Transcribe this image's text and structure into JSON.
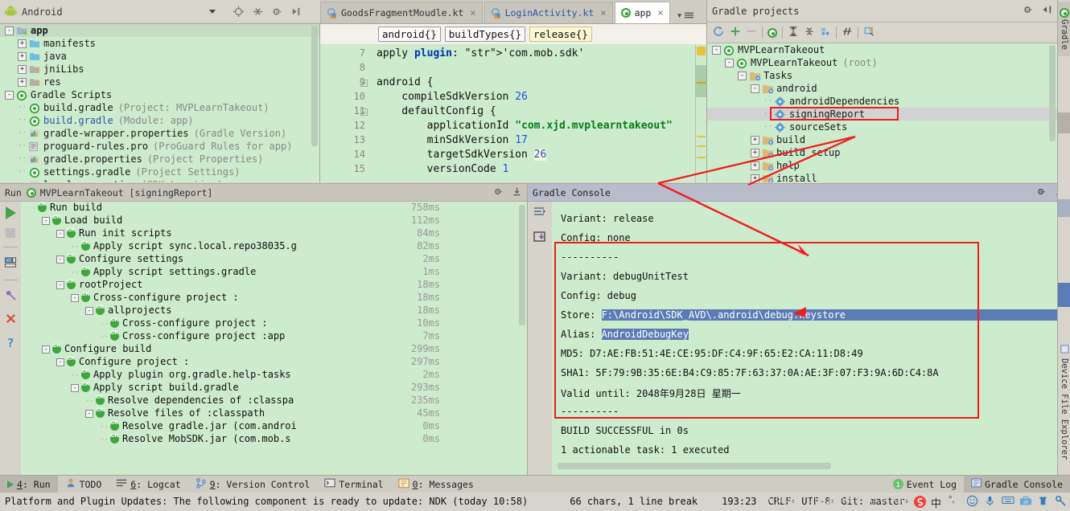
{
  "window": {
    "project_panel_title": "Android",
    "gradle_panel_title": "Gradle projects",
    "run_panel_title": "Run",
    "run_config": "MVPLearnTakeout [signingReport]",
    "console_title": "Gradle Console"
  },
  "editor_tabs": [
    {
      "label": "GoodsFragmentMoudle.kt",
      "icon": "kotlin-file-icon",
      "active": false,
      "close": "×"
    },
    {
      "label": "LoginActivity.kt",
      "icon": "kotlin-file-icon",
      "active": false,
      "close": "×"
    },
    {
      "label": "app",
      "icon": "gradle-file-icon",
      "active": true,
      "close": "×"
    }
  ],
  "breadcrumbs": [
    {
      "label": "android{}",
      "highlight": false
    },
    {
      "label": "buildTypes{}",
      "highlight": false
    },
    {
      "label": "release{}",
      "highlight": true
    }
  ],
  "project_tree": [
    {
      "indent": 0,
      "expander": "-",
      "icon": "folder-module-icon",
      "label": "app",
      "sub": "",
      "bold": true
    },
    {
      "indent": 1,
      "expander": "+",
      "icon": "folder-blue-icon",
      "label": "manifests",
      "sub": ""
    },
    {
      "indent": 1,
      "expander": "+",
      "icon": "folder-blue-icon",
      "label": "java",
      "sub": ""
    },
    {
      "indent": 1,
      "expander": "+",
      "icon": "folder-grey-icon",
      "label": "jniLibs",
      "sub": ""
    },
    {
      "indent": 1,
      "expander": "+",
      "icon": "folder-grey-icon",
      "label": "res",
      "sub": ""
    },
    {
      "indent": 0,
      "expander": "-",
      "icon": "gradle-icon",
      "label": "Gradle Scripts",
      "sub": ""
    },
    {
      "indent": 1,
      "expander": "",
      "icon": "gradle-icon",
      "label": "build.gradle",
      "sub": "(Project: MVPLearnTakeout)"
    },
    {
      "indent": 1,
      "expander": "",
      "icon": "gradle-icon",
      "label": "build.gradle",
      "sub": "(Module: app)",
      "link": true
    },
    {
      "indent": 1,
      "expander": "",
      "icon": "properties-icon",
      "label": "gradle-wrapper.properties",
      "sub": "(Gradle Version)"
    },
    {
      "indent": 1,
      "expander": "",
      "icon": "text-file-icon",
      "label": "proguard-rules.pro",
      "sub": "(ProGuard Rules for app)"
    },
    {
      "indent": 1,
      "expander": "",
      "icon": "properties-icon",
      "label": "gradle.properties",
      "sub": "(Project Properties)"
    },
    {
      "indent": 1,
      "expander": "",
      "icon": "gradle-icon",
      "label": "settings.gradle",
      "sub": "(Project Settings)"
    },
    {
      "indent": 1,
      "expander": "",
      "icon": "properties-icon",
      "label": "local.properties",
      "sub": "(SDK Location)"
    }
  ],
  "code": {
    "lines": [
      {
        "no": "7",
        "fold": "",
        "text": "apply plugin: 'com.mob.sdk'"
      },
      {
        "no": "8",
        "fold": "",
        "text": ""
      },
      {
        "no": "9",
        "fold": "-",
        "text": "android {"
      },
      {
        "no": "10",
        "fold": "",
        "text": "    compileSdkVersion 26"
      },
      {
        "no": "11",
        "fold": "-",
        "text": "    defaultConfig {"
      },
      {
        "no": "12",
        "fold": "",
        "text": "        applicationId \"com.xjd.mvplearntakeout\""
      },
      {
        "no": "13",
        "fold": "",
        "text": "        minSdkVersion 17"
      },
      {
        "no": "14",
        "fold": "",
        "text": "        targetSdkVersion 26"
      },
      {
        "no": "15",
        "fold": "",
        "text": "        versionCode 1"
      }
    ]
  },
  "gradle_tree": [
    {
      "indent": 0,
      "expander": "-",
      "icon": "gradle-icon",
      "label": "MVPLearnTakeout",
      "sub": ""
    },
    {
      "indent": 1,
      "expander": "-",
      "icon": "gradle-icon",
      "label": "MVPLearnTakeout",
      "sub": "(root)"
    },
    {
      "indent": 2,
      "expander": "-",
      "icon": "tasks-folder-icon",
      "label": "Tasks",
      "sub": ""
    },
    {
      "indent": 3,
      "expander": "-",
      "icon": "tasks-folder-icon",
      "label": "android",
      "sub": ""
    },
    {
      "indent": 4,
      "expander": "",
      "icon": "task-gear-icon",
      "label": "androidDependencies",
      "sub": ""
    },
    {
      "indent": 4,
      "expander": "",
      "icon": "task-gear-icon",
      "label": "signingReport",
      "sub": "",
      "selected": true,
      "boxed": true
    },
    {
      "indent": 4,
      "expander": "",
      "icon": "task-gear-icon",
      "label": "sourceSets",
      "sub": ""
    },
    {
      "indent": 3,
      "expander": "+",
      "icon": "tasks-folder-icon",
      "label": "build",
      "sub": ""
    },
    {
      "indent": 3,
      "expander": "+",
      "icon": "tasks-folder-icon",
      "label": "build setup",
      "sub": ""
    },
    {
      "indent": 3,
      "expander": "+",
      "icon": "tasks-folder-icon",
      "label": "help",
      "sub": ""
    },
    {
      "indent": 3,
      "expander": "+",
      "icon": "tasks-folder-icon",
      "label": "install",
      "sub": ""
    }
  ],
  "gradle_toolbar_icons": [
    "refresh-icon",
    "add-icon",
    "remove-icon",
    "run-task-icon",
    "expand-all-icon",
    "collapse-all-icon",
    "toggle-offline-icon",
    "execute-task-icon",
    "task-settings-icon"
  ],
  "run_toolbar_icons": [
    "rerun-icon",
    "stop-icon",
    "toggle-tasks-icon",
    "pin-icon",
    "close-icon",
    "help-icon"
  ],
  "run_tree": [
    {
      "indent": 0,
      "expander": "",
      "label": "Run build",
      "ms": "758ms"
    },
    {
      "indent": 1,
      "expander": "-",
      "label": "Load build",
      "ms": "112ms"
    },
    {
      "indent": 2,
      "expander": "-",
      "label": "Run init scripts",
      "ms": "84ms"
    },
    {
      "indent": 3,
      "expander": "",
      "label": "Apply script sync.local.repo38035.g",
      "ms": "82ms"
    },
    {
      "indent": 2,
      "expander": "-",
      "label": "Configure settings",
      "ms": "2ms"
    },
    {
      "indent": 3,
      "expander": "",
      "label": "Apply script settings.gradle",
      "ms": "1ms"
    },
    {
      "indent": 2,
      "expander": "-",
      "label": "rootProject",
      "ms": "18ms"
    },
    {
      "indent": 3,
      "expander": "-",
      "label": "Cross-configure project :",
      "ms": "18ms"
    },
    {
      "indent": 4,
      "expander": "-",
      "label": "allprojects",
      "ms": "18ms"
    },
    {
      "indent": 5,
      "expander": "",
      "label": "Cross-configure project :",
      "ms": "10ms"
    },
    {
      "indent": 5,
      "expander": "",
      "label": "Cross-configure project :app",
      "ms": "7ms"
    },
    {
      "indent": 1,
      "expander": "-",
      "label": "Configure build",
      "ms": "299ms"
    },
    {
      "indent": 2,
      "expander": "-",
      "label": "Configure project :",
      "ms": "297ms"
    },
    {
      "indent": 3,
      "expander": "",
      "label": "Apply plugin org.gradle.help-tasks",
      "ms": "2ms"
    },
    {
      "indent": 3,
      "expander": "-",
      "label": "Apply script build.gradle",
      "ms": "293ms"
    },
    {
      "indent": 4,
      "expander": "",
      "label": "Resolve dependencies of :classpa",
      "ms": "235ms"
    },
    {
      "indent": 4,
      "expander": "-",
      "label": "Resolve files of :classpath",
      "ms": "45ms"
    },
    {
      "indent": 5,
      "expander": "",
      "label": "Resolve gradle.jar (com.androi",
      "ms": "0ms"
    },
    {
      "indent": 5,
      "expander": "",
      "label": "Resolve MobSDK.jar (com.mob.s",
      "ms": "0ms"
    }
  ],
  "console": {
    "lines": [
      {
        "text": "Variant: release",
        "style": "plain"
      },
      {
        "text": "Config: none",
        "style": "plain"
      },
      {
        "text": "----------",
        "style": "plain"
      },
      {
        "text": "Variant: debugUnitTest",
        "style": "plain"
      },
      {
        "text": "Config: debug",
        "style": "plain"
      },
      {
        "text": "Store: ",
        "value": "F:\\Android\\SDK_AVD\\.android\\debug.keystore",
        "style": "store-selected"
      },
      {
        "text": "Alias: ",
        "value": "AndroidDebugKey",
        "style": "alias-selected"
      },
      {
        "text": "MD5: D7:AE:FB:51:4E:CE:95:DF:C4:9F:65:E2:CA:11:D8:49",
        "style": "plain"
      },
      {
        "text": "SHA1: 5F:79:9B:35:6E:B4:C9:85:7F:63:37:0A:AE:3F:07:F3:9A:6D:C4:8A",
        "style": "plain"
      },
      {
        "text": "Valid until: 2048年9月28日 星期一",
        "style": "plain"
      },
      {
        "text": "----------",
        "style": "plain"
      },
      {
        "text": "BUILD SUCCESSFUL in 0s",
        "style": "plain"
      },
      {
        "text": "1 actionable task: 1 executed",
        "style": "plain"
      }
    ]
  },
  "right_edge_tabs": [
    {
      "label": "Gradle",
      "icon": "gradle-icon"
    },
    {
      "label": "Device File Explorer",
      "icon": "device-file-icon"
    }
  ],
  "bottom_tabs": [
    {
      "num": "4",
      "label": "Run",
      "icon": "run-icon",
      "selected": true
    },
    {
      "num": "",
      "label": "TODO",
      "icon": "todo-icon",
      "selected": false
    },
    {
      "num": "6",
      "label": "Logcat",
      "icon": "logcat-icon",
      "selected": false
    },
    {
      "num": "9",
      "label": "Version Control",
      "icon": "vcs-icon",
      "selected": false
    },
    {
      "num": "",
      "label": "Terminal",
      "icon": "terminal-icon",
      "selected": false
    },
    {
      "num": "0",
      "label": "Messages",
      "icon": "messages-icon",
      "selected": false
    }
  ],
  "bottom_right_tabs": [
    {
      "label": "Event Log",
      "badge": "1",
      "icon": "event-log-icon"
    },
    {
      "label": "Gradle Console",
      "badge": "",
      "icon": "gradle-console-icon",
      "selected": true
    }
  ],
  "status_bar": {
    "message": "Platform and Plugin Updates: The following component is ready to update: NDK (today 10:58)",
    "chars": "66 chars, 1 line break",
    "caret": "193:23",
    "line_sep": "CRLF",
    "encoding": "UTF-8",
    "branch": "Git: master",
    "watermark": "https://blog.csdn.net/laukou63325400"
  },
  "colors": {
    "panel_bg": "#d6d4cc",
    "editor_bg": "#cdebcd",
    "selection_blue": "#5b7bb5",
    "annotation_red": "#f01d1d",
    "keyword_blue": "#0033b3",
    "string_green": "#067d17",
    "number_blue": "#1750eb",
    "highlight_yellow": "#fbf6d3"
  }
}
